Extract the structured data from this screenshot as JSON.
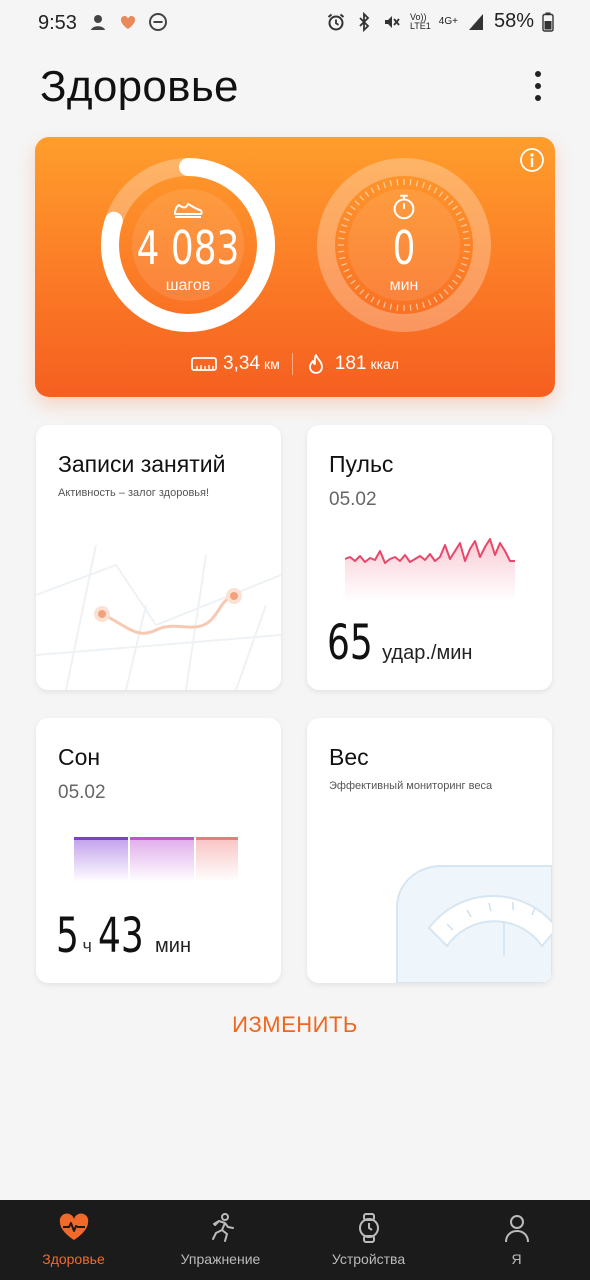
{
  "status_bar": {
    "time": "9:53",
    "battery": "58%",
    "network_label_top": "Vo))",
    "network_label_bottom": "LTE1",
    "network_gen": "4G+"
  },
  "header": {
    "title": "Здоровье",
    "menu_icon": "more-vertical-icon"
  },
  "activity": {
    "steps_value": "4 083",
    "steps_unit": "шагов",
    "steps_progress": 0.8,
    "minutes_value": "0",
    "minutes_unit": "мин",
    "distance_value": "3,34",
    "distance_unit": "км",
    "calories_value": "181",
    "calories_unit": "ккал",
    "accent_color": "#fb7a26"
  },
  "cards": {
    "workouts": {
      "title": "Записи занятий",
      "subtitle": "Активность – залог здоровья!"
    },
    "pulse": {
      "title": "Пульс",
      "date": "05.02",
      "value": "65",
      "unit": "удар./мин",
      "line_color": "#e8476a"
    },
    "sleep": {
      "title": "Сон",
      "date": "05.02",
      "hours": "5",
      "hours_unit": "ч",
      "minutes": "43",
      "minutes_unit": "мин"
    },
    "weight": {
      "title": "Вес",
      "subtitle": "Эффективный мониторинг веса"
    }
  },
  "edit_button": "ИЗМЕНИТЬ",
  "nav": {
    "items": [
      {
        "label": "Здоровье",
        "icon": "heart-pulse-icon",
        "active": true
      },
      {
        "label": "Упражнение",
        "icon": "running-icon",
        "active": false
      },
      {
        "label": "Устройства",
        "icon": "watch-icon",
        "active": false
      },
      {
        "label": "Я",
        "icon": "user-icon",
        "active": false
      }
    ],
    "active_color": "#f26a2a"
  }
}
